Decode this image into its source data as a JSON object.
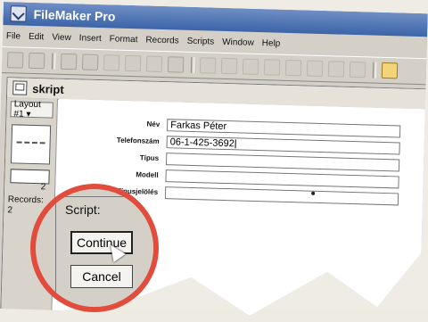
{
  "app": {
    "title": "FileMaker Pro"
  },
  "menu": {
    "items": [
      "File",
      "Edit",
      "View",
      "Insert",
      "Format",
      "Records",
      "Scripts",
      "Window",
      "Help"
    ]
  },
  "doc": {
    "title": "skript",
    "sidebar": {
      "layout_button": "Layout #1 ▾",
      "page_number": "2",
      "records_label": "Records:",
      "records_value": "2"
    },
    "fields": [
      {
        "label": "Név",
        "value": "Farkas Péter"
      },
      {
        "label": "Telefonszám",
        "value": "06-1-425-3692"
      },
      {
        "label": "Típus",
        "value": ""
      },
      {
        "label": "Modell",
        "value": ""
      },
      {
        "label": "Típusjelölés",
        "value": ""
      }
    ]
  },
  "script_dialog": {
    "label": "Script:",
    "continue": "Continue",
    "cancel": "Cancel"
  },
  "colors": {
    "title_bar": "#3c64a8",
    "callout_ring": "#e24c3c"
  }
}
